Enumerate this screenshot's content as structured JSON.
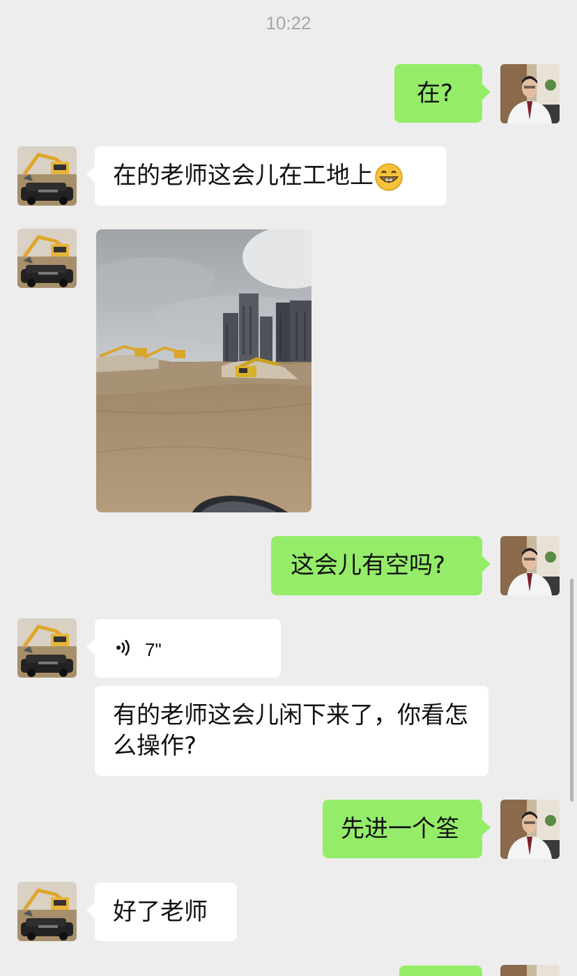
{
  "chat": {
    "timestamp": "10:22",
    "messages": [
      {
        "side": "out",
        "type": "text",
        "text": "在?"
      },
      {
        "side": "in",
        "type": "text",
        "text": "在的老师这会儿在工地上",
        "emoji": "grinning-face-emoji"
      },
      {
        "side": "in",
        "type": "image",
        "description": "construction site photo"
      },
      {
        "side": "out",
        "type": "text",
        "text": "这会儿有空吗?"
      },
      {
        "side": "in",
        "type": "voice",
        "duration": "7\""
      },
      {
        "side": "in",
        "type": "text",
        "text": "有的老师这会儿闲下来了，你看怎么操作?"
      },
      {
        "side": "out",
        "type": "text",
        "text": "先进一个筌"
      },
      {
        "side": "in",
        "type": "text",
        "text": "好了老师"
      }
    ]
  },
  "colors": {
    "background": "#ededed",
    "incoming_bubble": "#ffffff",
    "outgoing_bubble": "#95ec69",
    "timestamp": "#a6a6a6"
  }
}
